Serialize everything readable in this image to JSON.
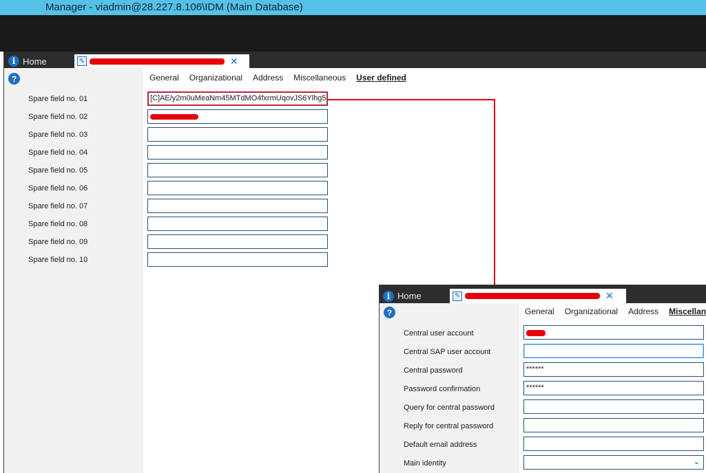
{
  "app": {
    "title": "Manager - viadmin@28.227.8.106\\IDM (Main Database)"
  },
  "main": {
    "tabs": {
      "home_label": "Home"
    },
    "nav": [
      "General",
      "Organizational",
      "Address",
      "Miscellaneous",
      "User defined"
    ],
    "active_nav": "User defined",
    "fields": [
      {
        "label": "Spare field no. 01",
        "value": "[C]AE/y2m0uMeaNm45MTdMO4fxrmUqovJS6Ylhg5"
      },
      {
        "label": "Spare field no. 02",
        "value": ""
      },
      {
        "label": "Spare field no. 03",
        "value": ""
      },
      {
        "label": "Spare field no. 04",
        "value": ""
      },
      {
        "label": "Spare field no. 05",
        "value": ""
      },
      {
        "label": "Spare field no. 06",
        "value": ""
      },
      {
        "label": "Spare field no. 07",
        "value": ""
      },
      {
        "label": "Spare field no. 08",
        "value": ""
      },
      {
        "label": "Spare field no. 09",
        "value": ""
      },
      {
        "label": "Spare field no. 10",
        "value": ""
      }
    ]
  },
  "second": {
    "tabs": {
      "home_label": "Home"
    },
    "nav": [
      "General",
      "Organizational",
      "Address",
      "Miscellaneous"
    ],
    "active_nav": "Miscellaneous",
    "fields": [
      {
        "label": "Central user account",
        "value": ""
      },
      {
        "label": "Central SAP user account",
        "value": ""
      },
      {
        "label": "Central password",
        "value": "******"
      },
      {
        "label": "Password confirmation",
        "value": "******"
      },
      {
        "label": "Query for central password",
        "value": ""
      },
      {
        "label": "Reply for central password",
        "value": ""
      },
      {
        "label": "Default email address",
        "value": ""
      },
      {
        "label": "Main identity",
        "value": ""
      }
    ]
  },
  "colors": {
    "titlebar": "#56c1e6",
    "highlight_border": "#b22a3a",
    "connector": "#e2001a"
  }
}
